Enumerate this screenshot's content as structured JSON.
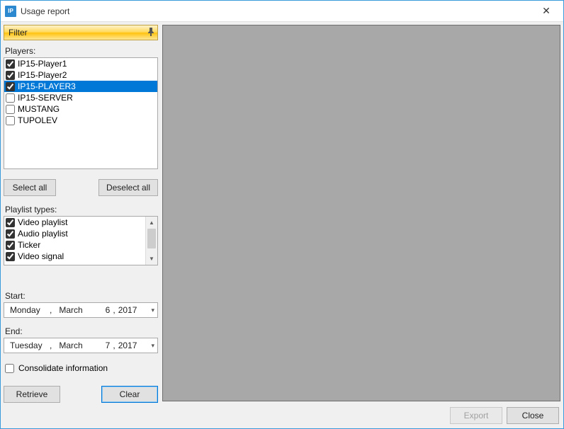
{
  "window": {
    "title": "Usage report",
    "icon_text": "IP"
  },
  "filter": {
    "header": "Filter"
  },
  "players": {
    "label": "Players:",
    "items": [
      {
        "label": "IP15-Player1",
        "checked": true,
        "selected": false
      },
      {
        "label": "IP15-Player2",
        "checked": true,
        "selected": false
      },
      {
        "label": "IP15-PLAYER3",
        "checked": true,
        "selected": true
      },
      {
        "label": "IP15-SERVER",
        "checked": false,
        "selected": false
      },
      {
        "label": "MUSTANG",
        "checked": false,
        "selected": false
      },
      {
        "label": "TUPOLEV",
        "checked": false,
        "selected": false
      }
    ]
  },
  "buttons": {
    "select_all": "Select all",
    "deselect_all": "Deselect all",
    "retrieve": "Retrieve",
    "clear": "Clear",
    "export": "Export",
    "close": "Close"
  },
  "playlist_types": {
    "label": "Playlist types:",
    "items": [
      {
        "label": "Video playlist",
        "checked": true
      },
      {
        "label": "Audio playlist",
        "checked": true
      },
      {
        "label": "Ticker",
        "checked": true
      },
      {
        "label": "Video signal",
        "checked": true
      }
    ]
  },
  "start": {
    "label": "Start:",
    "weekday": "Monday",
    "month": "March",
    "day": "6",
    "year": "2017"
  },
  "end": {
    "label": "End:",
    "weekday": "Tuesday",
    "month": "March",
    "day": "7",
    "year": "2017"
  },
  "consolidate": {
    "label": "Consolidate information",
    "checked": false
  }
}
